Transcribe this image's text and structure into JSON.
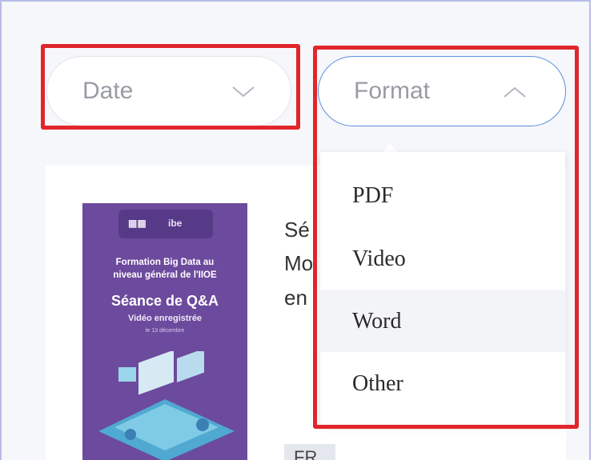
{
  "filters": {
    "date": {
      "label": "Date"
    },
    "format": {
      "label": "Format",
      "options": [
        "PDF",
        "Video",
        "Word",
        "Other"
      ]
    }
  },
  "card": {
    "thumbnail": {
      "logo_right": "ibe",
      "line1": "Formation Big Data au",
      "line2": "niveau général de l'IIOE",
      "title": "Séance de Q&A",
      "subtitle": "Vidéo enregistrée",
      "date": "le 13 décembre"
    },
    "title_fragments": [
      "Sé",
      "Mo",
      "en"
    ],
    "language_badge": "FR"
  },
  "colors": {
    "highlight": "#e0262b",
    "active_border": "#5b8fde",
    "thumb_bg": "#6c4a9d"
  },
  "icons": {
    "date_toggle": "chevron-down-icon",
    "format_toggle": "chevron-up-icon"
  }
}
